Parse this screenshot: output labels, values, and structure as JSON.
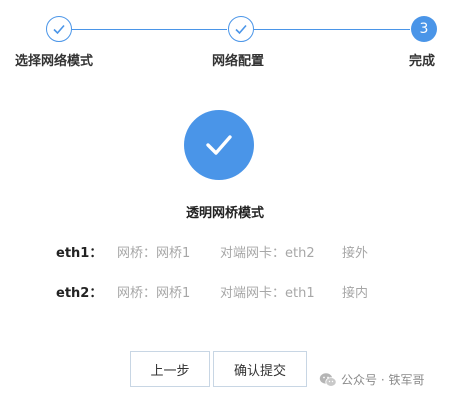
{
  "stepper": {
    "steps": [
      {
        "label": "选择网络模式",
        "status": "done"
      },
      {
        "label": "网络配置",
        "status": "done"
      },
      {
        "label": "完成",
        "status": "current",
        "number": "3"
      }
    ],
    "accent_color": "#4a95e8"
  },
  "result": {
    "icon": "check-icon",
    "title": "透明网桥模式"
  },
  "interfaces": [
    {
      "name": "eth1：",
      "bridge": "网桥：网桥1",
      "peer": "对端网卡：eth2",
      "direction": "接外"
    },
    {
      "name": "eth2：",
      "bridge": "网桥：网桥1",
      "peer": "对端网卡：eth1",
      "direction": "接内"
    }
  ],
  "buttons": {
    "prev": "上一步",
    "submit": "确认提交"
  },
  "watermark": {
    "text": "公众号 · 铁军哥",
    "icon": "wechat-icon"
  }
}
